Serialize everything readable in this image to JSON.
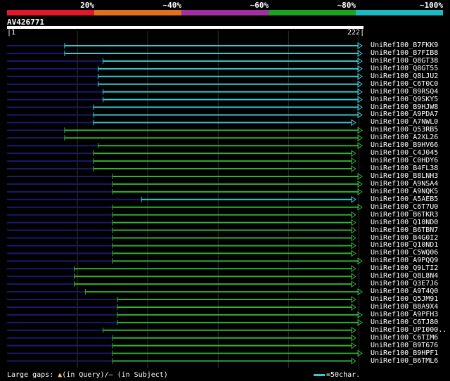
{
  "legend": {
    "labels": [
      "20%",
      "~40%",
      "~60%",
      "~80%",
      "~100%"
    ],
    "colors": [
      "#e0182c",
      "#e07020",
      "#a030a0",
      "#20a020",
      "#20b8c0"
    ]
  },
  "query": {
    "name": "AV426771",
    "start": "1",
    "end": "222",
    "length": 222
  },
  "grid_positions": [
    44,
    88,
    132,
    176,
    220
  ],
  "footer": {
    "gaps_text": "Large gaps:",
    "query_marker": "▲",
    "query_text": "(in Query)/",
    "subject_marker": "—",
    "subject_text": " (in Subject)",
    "scale_text": "=50char."
  },
  "colors": {
    "cyan": "#38c8d0",
    "green": "#30b030",
    "dark": "#1a1a70"
  },
  "hits": [
    {
      "name": "UniRef100_B7FKK9",
      "start": 36,
      "end": 222,
      "color": "cyan"
    },
    {
      "name": "UniRef100_B7FIB8",
      "start": 36,
      "end": 222,
      "color": "cyan"
    },
    {
      "name": "UniRef100_Q8GT38",
      "start": 60,
      "end": 222,
      "color": "cyan"
    },
    {
      "name": "UniRef100_Q8GT55",
      "start": 57,
      "end": 222,
      "color": "cyan"
    },
    {
      "name": "UniRef100_Q8LJU2",
      "start": 57,
      "end": 222,
      "color": "cyan"
    },
    {
      "name": "UniRef100_C6T0C0",
      "start": 57,
      "end": 222,
      "color": "cyan"
    },
    {
      "name": "UniRef100_B9RSQ4",
      "start": 60,
      "end": 222,
      "color": "cyan"
    },
    {
      "name": "UniRef100_Q9SKY5",
      "start": 60,
      "end": 222,
      "color": "cyan"
    },
    {
      "name": "UniRef100_B9HJW8",
      "start": 54,
      "end": 222,
      "color": "cyan"
    },
    {
      "name": "UniRef100_A9PDA7",
      "start": 54,
      "end": 222,
      "color": "cyan"
    },
    {
      "name": "UniRef100_A7NWL0",
      "start": 54,
      "end": 218,
      "color": "cyan"
    },
    {
      "name": "UniRef100_Q53RB5",
      "start": 36,
      "end": 222,
      "color": "green"
    },
    {
      "name": "UniRef100_A2XL26",
      "start": 36,
      "end": 222,
      "color": "green"
    },
    {
      "name": "UniRef100_B9HV66",
      "start": 57,
      "end": 222,
      "color": "green"
    },
    {
      "name": "UniRef100_C4J045",
      "start": 54,
      "end": 218,
      "color": "green"
    },
    {
      "name": "UniRef100_C0HDY6",
      "start": 54,
      "end": 218,
      "color": "green"
    },
    {
      "name": "UniRef100_B4FL38",
      "start": 54,
      "end": 218,
      "color": "green"
    },
    {
      "name": "UniRef100_B8LNH3",
      "start": 66,
      "end": 222,
      "color": "green"
    },
    {
      "name": "UniRef100_A9NSA4",
      "start": 66,
      "end": 222,
      "color": "green"
    },
    {
      "name": "UniRef100_A9NQK5",
      "start": 66,
      "end": 222,
      "color": "green"
    },
    {
      "name": "UniRef100_A5AEB5",
      "start": 84,
      "end": 218,
      "color": "cyan"
    },
    {
      "name": "UniRef100_C6T7U0",
      "start": 66,
      "end": 222,
      "color": "green"
    },
    {
      "name": "UniRef100_B6TKR3",
      "start": 66,
      "end": 218,
      "color": "green"
    },
    {
      "name": "UniRef100_Q10ND0",
      "start": 66,
      "end": 218,
      "color": "green"
    },
    {
      "name": "UniRef100_B6TBN7",
      "start": 66,
      "end": 218,
      "color": "green"
    },
    {
      "name": "UniRef100_B4G0I2",
      "start": 66,
      "end": 218,
      "color": "green"
    },
    {
      "name": "UniRef100_Q10ND1",
      "start": 66,
      "end": 218,
      "color": "green"
    },
    {
      "name": "UniRef100_C5WQ06",
      "start": 66,
      "end": 218,
      "color": "green"
    },
    {
      "name": "UniRef100_A9PQQ9",
      "start": 66,
      "end": 222,
      "color": "green"
    },
    {
      "name": "UniRef100_Q9LTI2",
      "start": 42,
      "end": 218,
      "color": "green"
    },
    {
      "name": "UniRef100_Q8L8N4",
      "start": 42,
      "end": 218,
      "color": "green"
    },
    {
      "name": "UniRef100_Q3E7J6",
      "start": 42,
      "end": 218,
      "color": "green"
    },
    {
      "name": "UniRef100_A9T4Q0",
      "start": 49,
      "end": 222,
      "color": "green"
    },
    {
      "name": "UniRef100_Q5JM91",
      "start": 69,
      "end": 218,
      "color": "green"
    },
    {
      "name": "UniRef100_B8A9X4",
      "start": 69,
      "end": 218,
      "color": "green"
    },
    {
      "name": "UniRef100_A9PFH3",
      "start": 69,
      "end": 222,
      "color": "green"
    },
    {
      "name": "UniRef100_C6TJ80",
      "start": 69,
      "end": 222,
      "color": "green"
    },
    {
      "name": "UniRef100_UPI000..",
      "start": 60,
      "end": 218,
      "color": "green"
    },
    {
      "name": "UniRef100_C6TIM6",
      "start": 66,
      "end": 218,
      "color": "green"
    },
    {
      "name": "UniRef100_B9T676",
      "start": 66,
      "end": 218,
      "color": "green"
    },
    {
      "name": "UniRef100_B9HPF1",
      "start": 66,
      "end": 222,
      "color": "green"
    },
    {
      "name": "UniRef100_B6TML6",
      "start": 66,
      "end": 218,
      "color": "green"
    }
  ]
}
